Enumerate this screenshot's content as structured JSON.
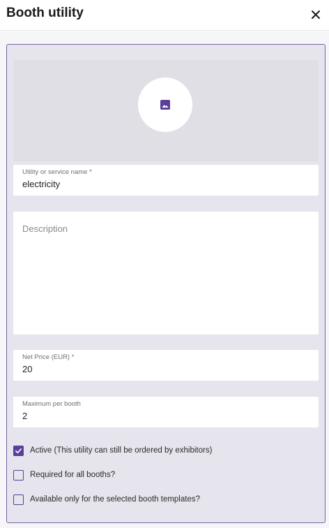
{
  "dialog": {
    "title": "Booth utility"
  },
  "form": {
    "name": {
      "label": "Utility or service name *",
      "value": "electricity"
    },
    "description": {
      "placeholder": "Description",
      "value": ""
    },
    "net_price": {
      "label": "Net Price (EUR) *",
      "value": "20"
    },
    "max_per_booth": {
      "label": "Maximum per booth",
      "value": "2"
    }
  },
  "checkboxes": [
    {
      "label": "Active (This utility can still be ordered by exhibitors)",
      "checked": true
    },
    {
      "label": "Required for all booths?",
      "checked": false
    },
    {
      "label": "Available only for the selected booth templates?",
      "checked": false
    }
  ],
  "icons": {
    "close": "close-icon",
    "image": "image-icon"
  },
  "colors": {
    "accent": "#5b3f99",
    "panel_border": "#7a62a8",
    "panel_bg": "#e6e4ec"
  }
}
